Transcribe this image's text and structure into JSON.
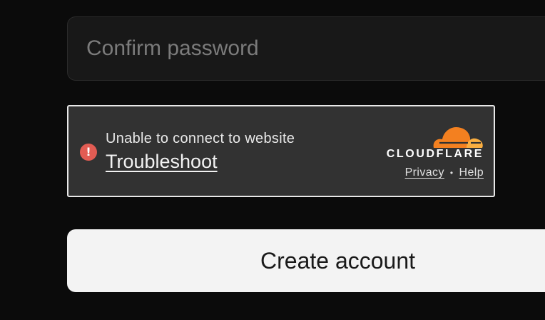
{
  "form": {
    "confirm_password": {
      "placeholder": "Confirm password",
      "value": ""
    },
    "create_account_label": "Create account"
  },
  "turnstile": {
    "status_text": "Unable to connect to website",
    "troubleshoot_label": "Troubleshoot",
    "brand_name": "CLOUDFLARE",
    "privacy_label": "Privacy",
    "separator": "•",
    "help_label": "Help",
    "error_icon": "alert-circle-icon",
    "colors": {
      "error": "#e25c53",
      "cloud_orange": "#f38020",
      "cloud_light_orange": "#faae40"
    }
  }
}
